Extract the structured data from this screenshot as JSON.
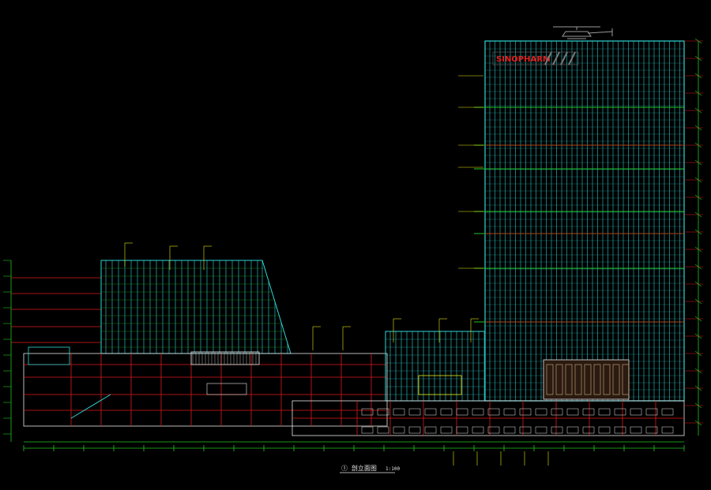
{
  "drawing": {
    "title_label": "①  剖立面图",
    "scale_label": "1:100",
    "roof_signage": "SINOPHARM",
    "colors": {
      "background": "#000000",
      "facade": "#2fd6d6",
      "structure": "#e01818",
      "dimension": "#22c422",
      "annotation": "#e8e810",
      "outline": "#e8e8e8",
      "signage": "#e02020"
    }
  }
}
